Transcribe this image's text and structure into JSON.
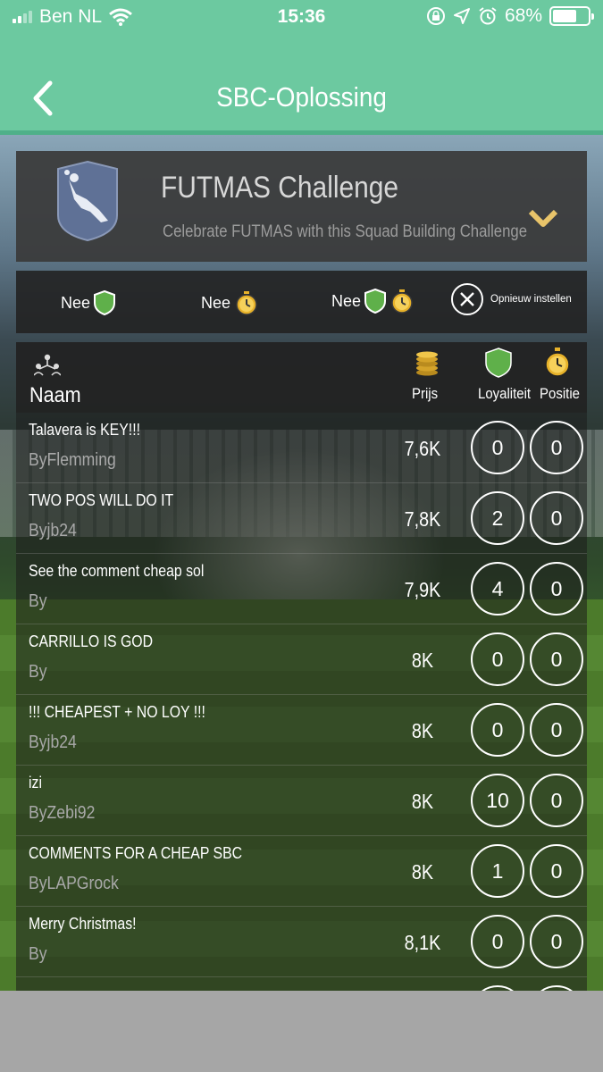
{
  "status_bar": {
    "carrier": "Ben NL",
    "time": "15:36",
    "battery": "68%",
    "battery_level": 0.68
  },
  "nav": {
    "title": "SBC-Oplossing"
  },
  "challenge": {
    "title": "FUTMAS Challenge",
    "subtitle": "Celebrate FUTMAS with this Squad Building Challenge"
  },
  "filters": {
    "loyalty": "Nee",
    "position": "Nee",
    "both": "Nee",
    "reset": "Opnieuw instellen"
  },
  "table": {
    "headers": {
      "name": "Naam",
      "price": "Prijs",
      "loyalty": "Loyaliteit",
      "position": "Positie"
    },
    "rows": [
      {
        "title": "Talavera is KEY!!!",
        "by": "ByFlemming",
        "price": "7,6K",
        "loyalty": "0",
        "position": "0"
      },
      {
        "title": "TWO POS WILL DO IT",
        "by": "Byjb24",
        "price": "7,8K",
        "loyalty": "2",
        "position": "0"
      },
      {
        "title": "See the comment cheap sol",
        "by": "By",
        "price": "7,9K",
        "loyalty": "4",
        "position": "0"
      },
      {
        "title": "CARRILLO IS GOD",
        "by": "By",
        "price": "8K",
        "loyalty": "0",
        "position": "0"
      },
      {
        "title": "!!! CHEAPEST + NO LOY !!!",
        "by": "Byjb24",
        "price": "8K",
        "loyalty": "0",
        "position": "0"
      },
      {
        "title": "izi",
        "by": "ByZebi92",
        "price": "8K",
        "loyalty": "10",
        "position": "0"
      },
      {
        "title": "COMMENTS FOR A CHEAP SBC",
        "by": "ByLAPGrock",
        "price": "8K",
        "loyalty": "1",
        "position": "0"
      },
      {
        "title": "Merry Christmas!",
        "by": "By",
        "price": "8,1K",
        "loyalty": "0",
        "position": "0"
      }
    ]
  },
  "colors": {
    "accent": "#6cc9a0",
    "shield_green": "#5fb04a",
    "gold": "#e7b22a"
  }
}
